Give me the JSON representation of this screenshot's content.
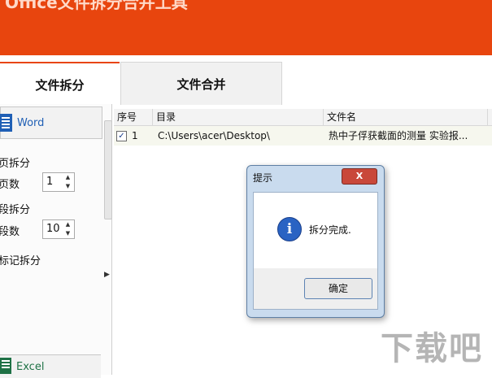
{
  "app": {
    "title": "Office文件拆分合并工具"
  },
  "tabs": [
    {
      "label": "文件拆分",
      "active": true
    },
    {
      "label": "文件合并",
      "active": false
    }
  ],
  "sidebar": {
    "word_label": "Word",
    "options": [
      {
        "label": "页拆分"
      },
      {
        "label": "页数",
        "value": "1"
      },
      {
        "label": "段拆分"
      },
      {
        "label": "段数",
        "value": "10"
      },
      {
        "label": "标记拆分"
      }
    ],
    "excel_label": "Excel"
  },
  "table": {
    "columns": [
      "序号",
      "目录",
      "文件名"
    ],
    "rows": [
      {
        "checked": true,
        "index": "1",
        "dir": "C:\\Users\\acer\\Desktop\\",
        "filename": "热中子俘获截面的测量 实验报..."
      }
    ]
  },
  "dialog": {
    "title": "提示",
    "message": "拆分完成.",
    "ok_label": "确定",
    "close_label": "X"
  },
  "watermark": "下载吧",
  "icons": {
    "word": "word-icon",
    "excel": "excel-icon",
    "info": "info-icon",
    "close": "close-icon",
    "spin_up": "spin-up-icon",
    "spin_down": "spin-down-icon",
    "splitter": "chevron-right-icon"
  },
  "colors": {
    "accent": "#e8450e",
    "word": "#1f5fb5",
    "excel": "#1e7145"
  }
}
